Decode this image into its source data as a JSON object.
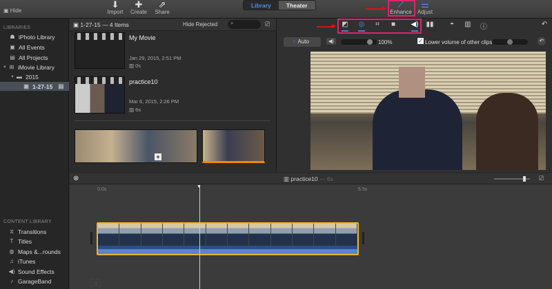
{
  "toolbar": {
    "hide": "Hide",
    "import": "Import",
    "create": "Create",
    "share": "Share",
    "library_tab": "Library",
    "theater_tab": "Theater",
    "enhance": "Enhance",
    "adjust": "Adjust"
  },
  "sidebar": {
    "libraries_heading": "LIBRARIES",
    "items": [
      {
        "label": "iPhoto Library"
      },
      {
        "label": "All Events"
      },
      {
        "label": "All Projects"
      },
      {
        "label": "iMovie Library"
      },
      {
        "label": "2015"
      },
      {
        "label": "1-27-15"
      }
    ],
    "content_heading": "CONTENT LIBRARY",
    "content_items": [
      {
        "label": "Transitions"
      },
      {
        "label": "Titles"
      },
      {
        "label": "Maps &...rounds"
      },
      {
        "label": "iTunes"
      },
      {
        "label": "Sound Effects"
      },
      {
        "label": "GarageBand"
      }
    ]
  },
  "browser": {
    "event_title": "1-27-15 — 4 Items",
    "filter": "Hide Rejected",
    "search_placeholder": "",
    "projects": [
      {
        "name": "My Movie",
        "date": "Jan 29, 2015, 2:51 PM",
        "duration": "0s"
      },
      {
        "name": "practice10",
        "date": "Mar 6, 2015, 2:26 PM",
        "duration": "6s"
      }
    ]
  },
  "viewer": {
    "auto": "Auto",
    "volume": "100%",
    "volume_level": 1.0,
    "lower_volume_label": "Lower volume of other clips",
    "lower_volume_checked": true
  },
  "timeline": {
    "title": "practice10",
    "duration": "6s",
    "start": "0.0s",
    "end": "6.5s"
  },
  "colors": {
    "accent": "#4a8ff0",
    "highlight": "#e0246e",
    "clip_border": "#e8b52c"
  }
}
